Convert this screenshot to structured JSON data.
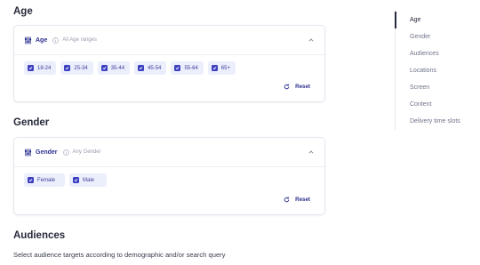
{
  "sections": {
    "age": {
      "title": "Age",
      "card_label": "Age",
      "card_sub": "All Age ranges",
      "options": [
        "18-24",
        "25-34",
        "35-44",
        "45-54",
        "55-64",
        "65+"
      ],
      "reset": "Reset"
    },
    "gender": {
      "title": "Gender",
      "card_label": "Gender",
      "card_sub": "Any Gender",
      "options": [
        "Female",
        "Male"
      ],
      "reset": "Reset"
    },
    "audiences": {
      "title": "Audiences",
      "description": "Select audience targets according to demographic and/or search query"
    }
  },
  "side_nav": {
    "items": [
      "Age",
      "Gender",
      "Audiences",
      "Locations",
      "Screen",
      "Content",
      "Delivery time slots"
    ],
    "active": "Age"
  },
  "colors": {
    "accent": "#3d40c0",
    "accent_text": "#2c2f8f",
    "chip_bg": "#ebeefb"
  },
  "icons": {
    "card_header": "filter-sliders-icon",
    "info": "info-icon",
    "collapse": "chevron-up-icon",
    "reset": "refresh-icon",
    "checkbox": "checkbox-checked-icon"
  }
}
